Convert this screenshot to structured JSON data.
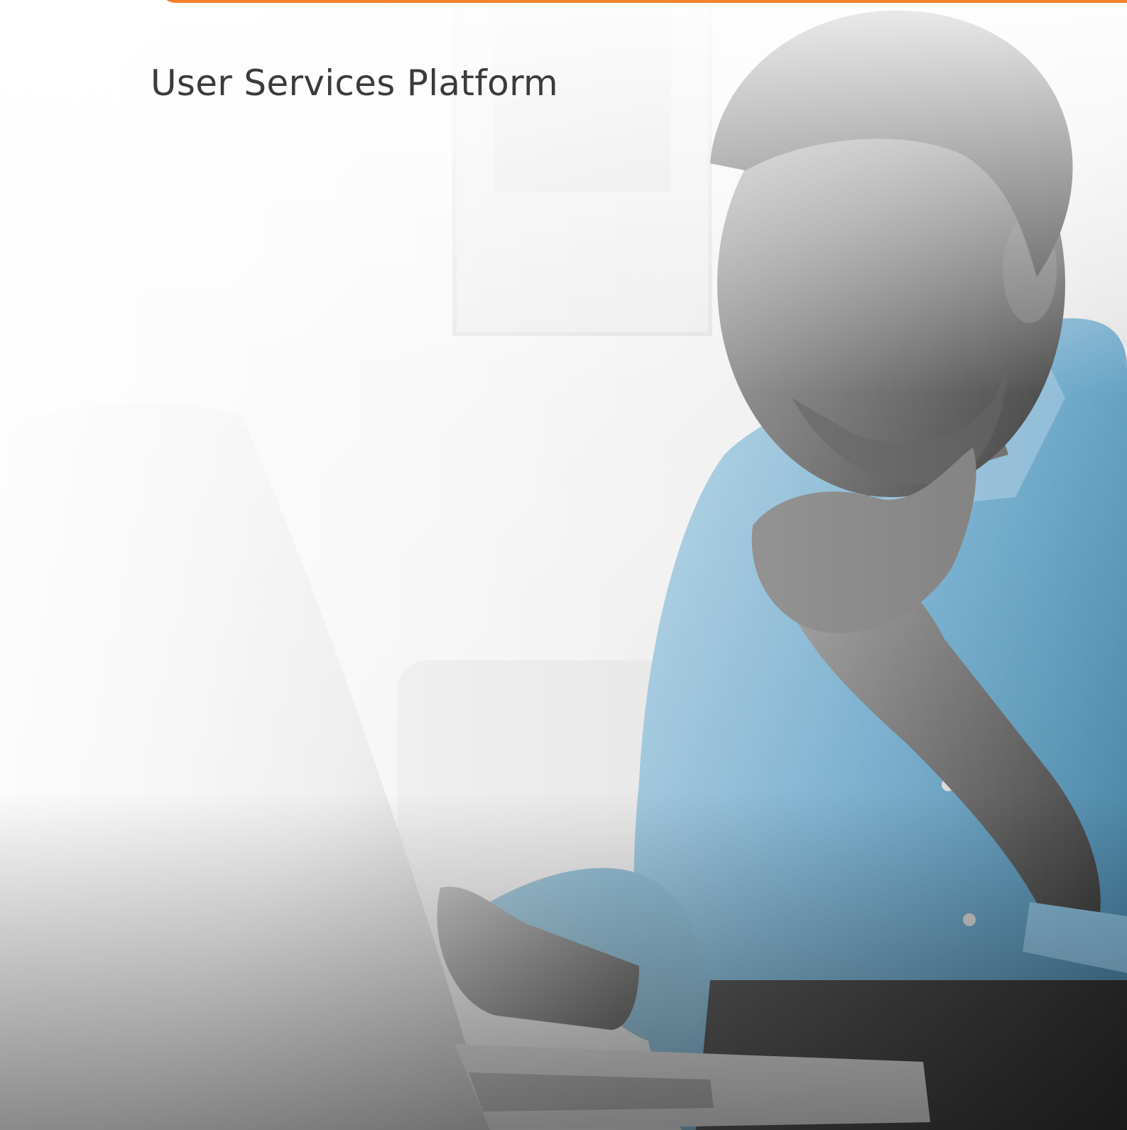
{
  "header": {
    "title": "User Services Platform"
  },
  "colors": {
    "accent": "#f58025",
    "title_text": "#3b3b3b",
    "shirt_blue": "#6aa6c8"
  },
  "hero_image": {
    "icon": "man-with-laptop-photo"
  }
}
